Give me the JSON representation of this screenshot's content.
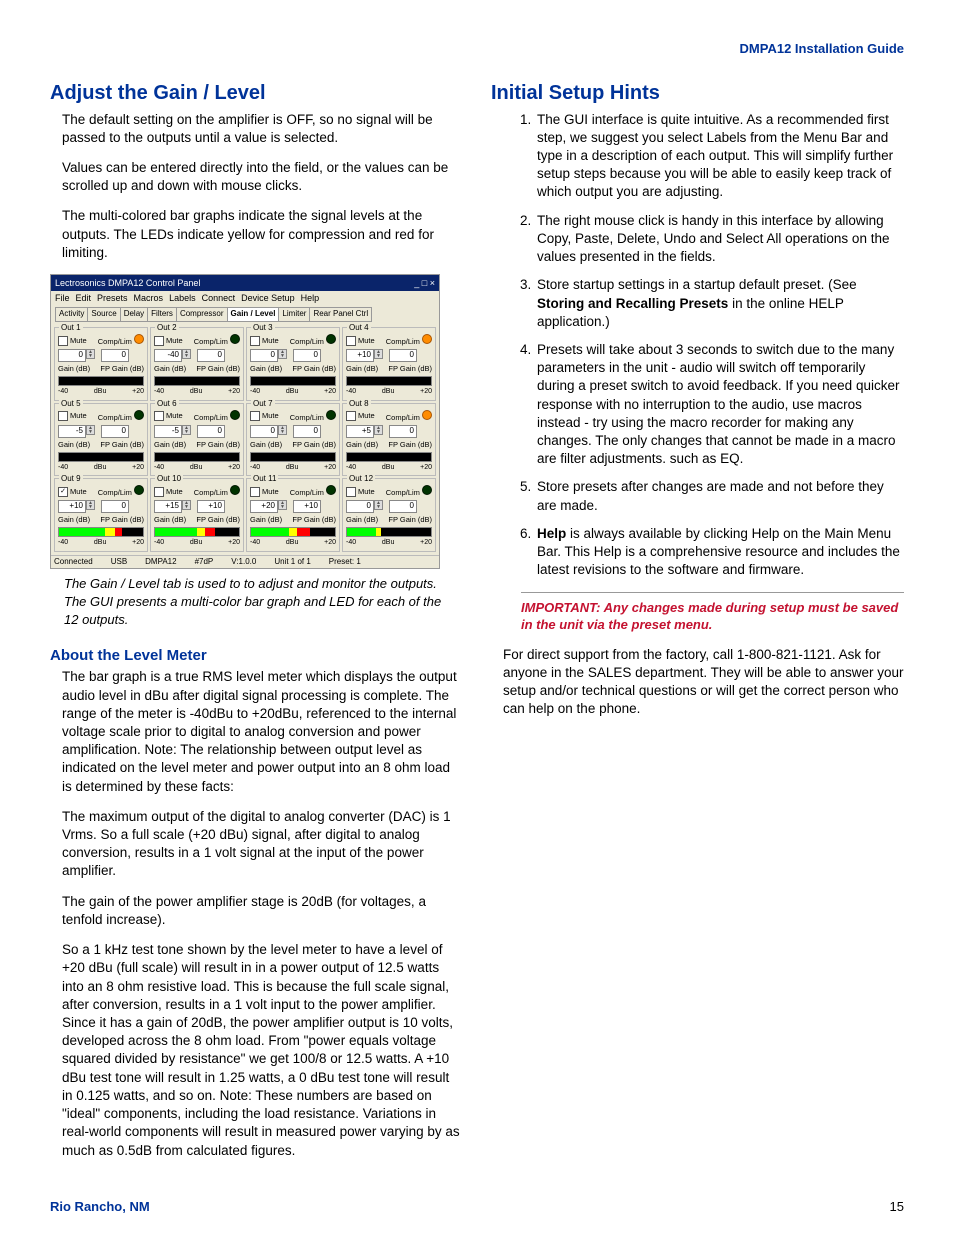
{
  "header": {
    "title": "DMPA12 Installation Guide"
  },
  "left": {
    "h_adjust": "Adjust the Gain / Level",
    "p1": "The default setting on the amplifier is OFF, so no signal will be passed to the outputs until a value is selected.",
    "p2": "Values can be entered directly into the field, or the values can be scrolled up and down with mouse clicks.",
    "p3": "The multi-colored bar graphs indicate the signal levels at the outputs. The LEDs indicate yellow for compression and red for limiting.",
    "caption": "The Gain / Level tab is used to to adjust and monitor the outputs. The GUI presents a multi-color bar graph and LED for each of the 12 outputs.",
    "h_about": "About the Level Meter",
    "a1": "The bar graph is a true RMS level meter which displays the output audio level in dBu after digital signal processing is complete. The range of the meter is -40dBu to +20dBu, referenced to the internal voltage scale prior to digital to analog conversion and power amplification. Note: The relationship between output level as indicated on the level meter and power output into an 8 ohm load is determined by these facts:",
    "a2": "The maximum output of the digital to analog converter (DAC) is 1 Vrms. So a full scale (+20 dBu) signal, after digital to analog conversion, results in a 1 volt signal at the input of the power amplifier.",
    "a3": "The gain of the power amplifier stage is 20dB (for voltages, a tenfold increase).",
    "a4": "So a 1 kHz test tone shown by the level meter to have a level of +20 dBu (full scale) will result in in a power output of 12.5 watts into an 8 ohm resistive load. This is because the full scale signal, after conversion, results in a 1 volt input to the power amplifier. Since it has a gain of 20dB, the power amplifier output is 10 volts, developed across the 8 ohm load. From \"power equals voltage squared divided by resistance\" we get 100/8 or 12.5 watts. A +10 dBu test tone will result in 1.25 watts, a 0 dBu test tone will result in 0.125 watts, and so on. Note: These numbers are based on \"ideal\" components, including the load resistance. Variations in real-world components will result in measured power varying by as much as 0.5dB from calculated figures."
  },
  "right": {
    "h_initial": "Initial Setup Hints",
    "hints": [
      "The GUI interface is quite intuitive. As a recommended first step, we suggest you select Labels from the Menu Bar and type in a description of each output. This will simplify further setup steps because you will be able to easily keep track of which output you are adjusting.",
      "The right mouse click is handy in this interface by allowing Copy, Paste, Delete, Undo and Select All operations on the values presented in the fields.",
      "Store startup settings in a startup default preset. (See Storing and Recalling Presets in the online HELP application.)",
      "Presets will take about 3 seconds to switch due to the many parameters in the unit - audio will switch off temporarily during a preset switch to avoid feedback.  If you need quicker response with no interruption to the audio, use macros instead - try using the macro recorder for making any changes.   The only changes that cannot be made in a macro are filter adjustments. such as EQ.",
      "Store presets after changes are made and not before they are made.",
      "Help is always available by clicking Help on the Main Menu Bar.  This Help is a comprehensive resource and includes the latest revisions to the software and firmware."
    ],
    "hint3_bold": "Storing and Recalling Presets",
    "hint6_bold": "Help",
    "important": "IMPORTANT: Any changes made during setup must be saved in the unit via the preset menu.",
    "support": "For direct support from the factory, call 1-800-821-1121. Ask for anyone in the SALES department.  They will be able to answer your setup and/or technical questions or will get the correct person who can help on the phone."
  },
  "screenshot": {
    "title": "Lectrosonics DMPA12 Control Panel",
    "menus": [
      "File",
      "Edit",
      "Presets",
      "Macros",
      "Labels",
      "Connect",
      "Device Setup",
      "Help"
    ],
    "tabs": [
      "Activity",
      "Source",
      "Delay",
      "Filters",
      "Compressor",
      "Gain / Level",
      "Limiter",
      "Rear Panel Ctrl"
    ],
    "selected_tab": "Gain / Level",
    "mute": "Mute",
    "complim": "Comp/Lim",
    "gain_lbl": "Gain (dB)",
    "fpgain_lbl": "FP Gain (dB)",
    "tick_lo": "-40",
    "tick_mid": "dBu",
    "tick_hi": "+20",
    "outs": [
      {
        "n": "Out 1",
        "g": "0",
        "fp": "0",
        "led": "orange",
        "checked": false,
        "bar": [
          0,
          0,
          0
        ]
      },
      {
        "n": "Out 2",
        "g": "-40",
        "fp": "0",
        "led": "dark",
        "checked": false,
        "bar": [
          0,
          0,
          0
        ]
      },
      {
        "n": "Out 3",
        "g": "0",
        "fp": "0",
        "led": "dark",
        "checked": false,
        "bar": [
          0,
          0,
          0
        ]
      },
      {
        "n": "Out 4",
        "g": "+10",
        "fp": "0",
        "led": "orange",
        "checked": false,
        "bar": [
          0,
          0,
          0
        ]
      },
      {
        "n": "Out 5",
        "g": "-5",
        "fp": "0",
        "led": "dark",
        "checked": false,
        "bar": [
          0,
          0,
          0
        ]
      },
      {
        "n": "Out 6",
        "g": "-5",
        "fp": "0",
        "led": "dark",
        "checked": false,
        "bar": [
          0,
          0,
          0
        ]
      },
      {
        "n": "Out 7",
        "g": "0",
        "fp": "0",
        "led": "dark",
        "checked": false,
        "bar": [
          0,
          0,
          0
        ]
      },
      {
        "n": "Out 8",
        "g": "+5",
        "fp": "0",
        "led": "orange",
        "checked": false,
        "bar": [
          0,
          0,
          0
        ]
      },
      {
        "n": "Out 9",
        "g": "+10",
        "fp": "0",
        "led": "dark",
        "checked": true,
        "bar": [
          55,
          12,
          8
        ]
      },
      {
        "n": "Out 10",
        "g": "+15",
        "fp": "+10",
        "led": "dark",
        "checked": false,
        "bar": [
          50,
          10,
          12
        ]
      },
      {
        "n": "Out 11",
        "g": "+20",
        "fp": "+10",
        "led": "dark",
        "checked": false,
        "bar": [
          45,
          10,
          15
        ]
      },
      {
        "n": "Out 12",
        "g": "0",
        "fp": "0",
        "led": "dark",
        "checked": false,
        "bar": [
          35,
          5,
          0
        ]
      }
    ],
    "status": [
      "Connected",
      "USB",
      "DMPA12",
      "#7dP",
      "V:1.0.0",
      "Unit 1 of 1",
      "Preset: 1"
    ]
  },
  "footer": {
    "loc": "Rio Rancho, NM",
    "page": "15"
  }
}
